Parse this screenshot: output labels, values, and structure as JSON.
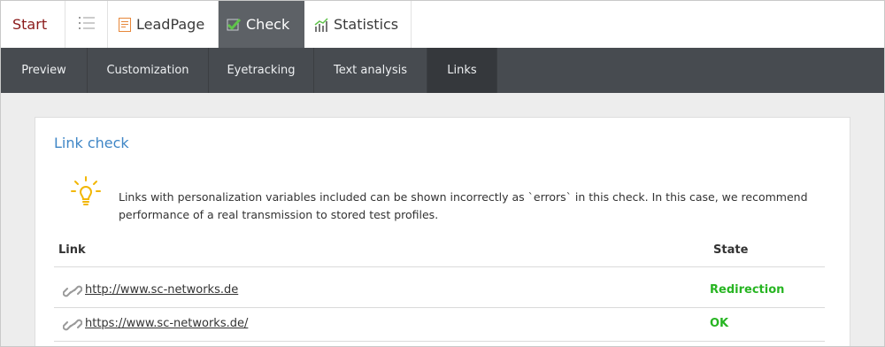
{
  "topnav": {
    "start": "Start",
    "leadpage": "LeadPage",
    "check": "Check",
    "statistics": "Statistics"
  },
  "subnav": {
    "items": [
      "Preview",
      "Customization",
      "Eyetracking",
      "Text analysis",
      "Links"
    ],
    "active": "Links"
  },
  "panel": {
    "title": "Link check",
    "notice": "Links with personalization variables included can be shown incorrectly as `errors` in this check. In this case, we recommend performance of a real transmission to stored test profiles."
  },
  "table": {
    "headers": {
      "link": "Link",
      "state": "State"
    },
    "rows": [
      {
        "url": "http://www.sc-networks.de",
        "state": "Redirection"
      },
      {
        "url": "https://www.sc-networks.de/",
        "state": "OK"
      }
    ]
  },
  "colors": {
    "accent_blue": "#3f86c6",
    "start_red": "#8b1a1a",
    "state_green": "#27b522",
    "check_tab": "#5d6166",
    "subnav_bg": "#474b50"
  }
}
